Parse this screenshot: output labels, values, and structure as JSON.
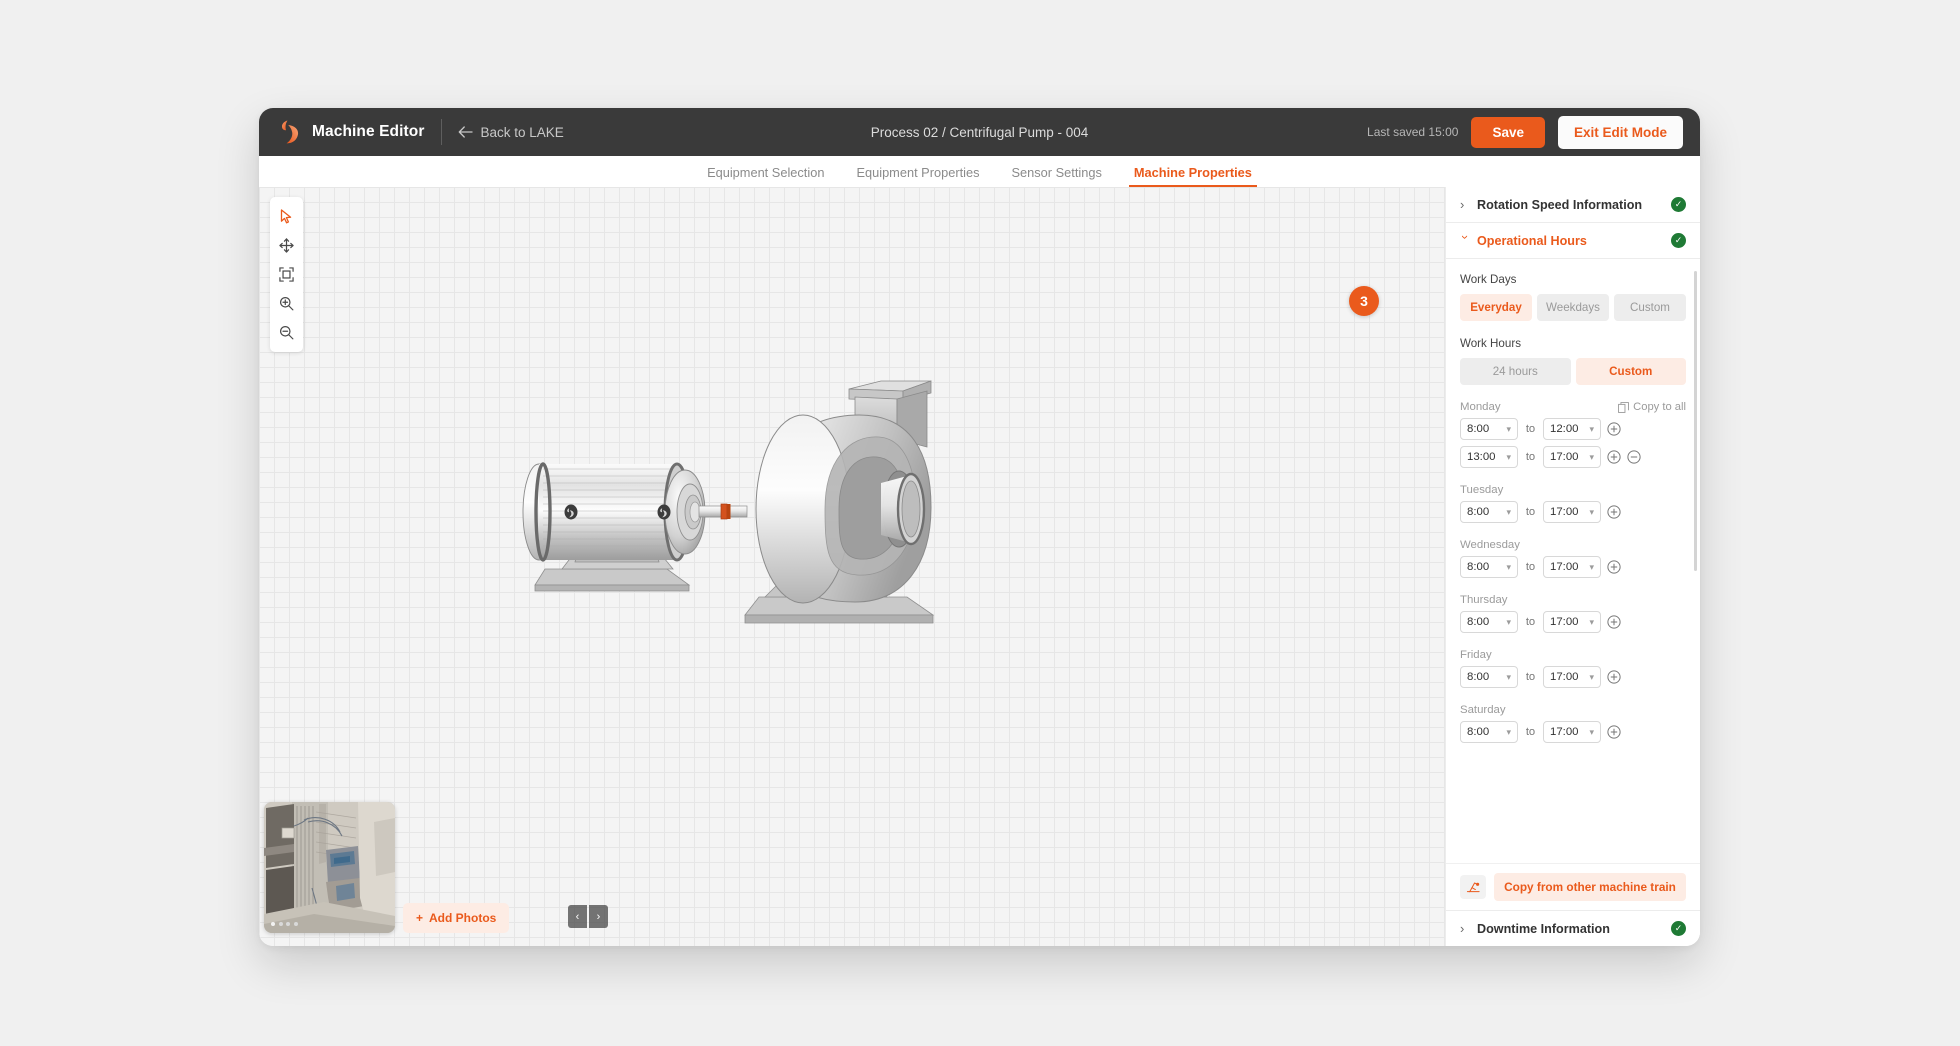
{
  "header": {
    "brand_title": "Machine Editor",
    "logo_icon": "leaf-logo-icon",
    "back_icon": "arrow-left-icon",
    "back_label": "Back to LAKE",
    "doc_title": "Process 02 / Centrifugal Pump - 004",
    "last_saved": "Last saved 15:00",
    "save_label": "Save",
    "exit_label": "Exit Edit Mode",
    "bg_color": "#3a3a3a",
    "accent_color": "#ea5a1c"
  },
  "tabs": [
    {
      "label": "Equipment Selection",
      "active": false
    },
    {
      "label": "Equipment Properties",
      "active": false
    },
    {
      "label": "Sensor Settings",
      "active": false
    },
    {
      "label": "Machine Properties",
      "active": true
    }
  ],
  "toolbar": {
    "items": [
      {
        "icon": "cursor-select-icon",
        "active": true
      },
      {
        "icon": "move-pan-icon",
        "active": false
      },
      {
        "icon": "fit-to-frame-icon",
        "active": false
      },
      {
        "icon": "zoom-in-icon",
        "active": false
      },
      {
        "icon": "zoom-out-icon",
        "active": false
      }
    ]
  },
  "canvas": {
    "machine_illustration": "motor-and-centrifugal-pump-3d",
    "grid_size_px": 15,
    "grid_color": "#e6e6e6",
    "background_color": "#f4f4f4"
  },
  "photos": {
    "thumbnail_alt": "industrial machine site photo",
    "dots": 4,
    "active_dot": 0,
    "prev_icon": "chevron-left-icon",
    "prev_label": "‹",
    "next_icon": "chevron-right-icon",
    "next_label": "›",
    "add_plus": "+",
    "add_label": "Add Photos"
  },
  "panel": {
    "sections": [
      {
        "title": "Rotation Speed Information",
        "open": false,
        "complete": true
      },
      {
        "title": "Operational Hours",
        "open": true,
        "complete": true
      },
      {
        "title": "Downtime Information",
        "open": false,
        "complete": true
      }
    ],
    "work_days": {
      "label": "Work Days",
      "options": [
        {
          "label": "Everyday",
          "selected": true
        },
        {
          "label": "Weekdays",
          "selected": false
        },
        {
          "label": "Custom",
          "selected": false
        }
      ]
    },
    "work_hours": {
      "label": "Work Hours",
      "options": [
        {
          "label": "24 hours",
          "selected": false
        },
        {
          "label": "Custom",
          "selected": true
        }
      ]
    },
    "copy_to_all": {
      "label": "Copy to all",
      "icon": "copy-icon"
    },
    "to_label": "to",
    "add_icon": "plus-circle-icon",
    "remove_icon": "minus-circle-icon",
    "days": [
      {
        "name": "Monday",
        "show_copy_to_all": true,
        "slots": [
          {
            "from": "8:00",
            "to": "12:00",
            "can_add": true,
            "can_remove": false
          },
          {
            "from": "13:00",
            "to": "17:00",
            "can_add": true,
            "can_remove": true
          }
        ]
      },
      {
        "name": "Tuesday",
        "show_copy_to_all": false,
        "slots": [
          {
            "from": "8:00",
            "to": "17:00",
            "can_add": true,
            "can_remove": false
          }
        ]
      },
      {
        "name": "Wednesday",
        "show_copy_to_all": false,
        "slots": [
          {
            "from": "8:00",
            "to": "17:00",
            "can_add": true,
            "can_remove": false
          }
        ]
      },
      {
        "name": "Thursday",
        "show_copy_to_all": false,
        "slots": [
          {
            "from": "8:00",
            "to": "17:00",
            "can_add": true,
            "can_remove": false
          }
        ]
      },
      {
        "name": "Friday",
        "show_copy_to_all": false,
        "slots": [
          {
            "from": "8:00",
            "to": "17:00",
            "can_add": true,
            "can_remove": false
          }
        ]
      },
      {
        "name": "Saturday",
        "show_copy_to_all": false,
        "slots": [
          {
            "from": "8:00",
            "to": "17:00",
            "can_add": true,
            "can_remove": false
          }
        ]
      }
    ],
    "copy_from_train": {
      "icon": "machine-train-icon",
      "label": "Copy from other machine train"
    }
  },
  "step_badge": {
    "value": "3"
  }
}
